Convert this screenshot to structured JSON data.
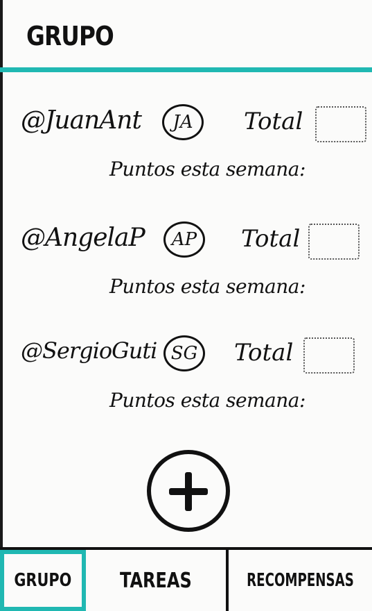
{
  "header": {
    "title": "GRUPO"
  },
  "members": [
    {
      "handle": "@JuanAnt",
      "initials": "JA",
      "total_label": "Total",
      "points_label": "Puntos esta semana:"
    },
    {
      "handle": "@AngelaP",
      "initials": "AP",
      "total_label": "Total",
      "points_label": "Puntos esta semana:"
    },
    {
      "handle": "@SergioGuti",
      "initials": "SG",
      "total_label": "Total",
      "points_label": "Puntos esta semana:"
    }
  ],
  "add_button": {
    "icon": "plus-icon"
  },
  "nav": {
    "tabs": [
      {
        "label": "GRUPO",
        "active": true
      },
      {
        "label": "TAREAS",
        "active": false
      },
      {
        "label": "RECOMPENSAS",
        "active": false
      }
    ]
  },
  "colors": {
    "accent": "#20b8b2",
    "ink": "#111111",
    "background": "#fbfbfa"
  }
}
